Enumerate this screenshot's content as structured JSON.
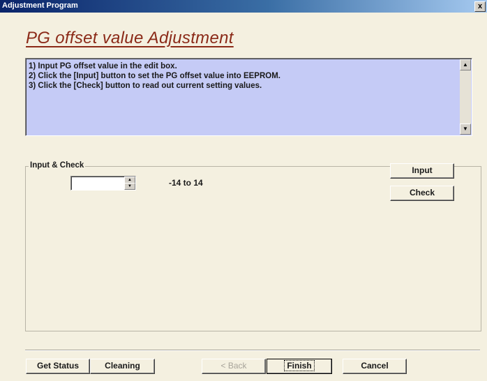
{
  "window": {
    "title": "Adjustment Program",
    "close_label": "x"
  },
  "heading": "PG offset value Adjustment",
  "instructions": [
    "1) Input PG offset value in the edit box.",
    "2) Click the [Input] button to set the PG offset value into EEPROM.",
    "3) Click the [Check] button to read out current setting values."
  ],
  "group": {
    "label": "Input & Check",
    "offset_value": "",
    "range_text": "-14 to 14",
    "input_label": "Input",
    "check_label": "Check"
  },
  "footer": {
    "get_status_label": "Get Status",
    "cleaning_label": "Cleaning",
    "back_label": "< Back",
    "finish_label": "Finish",
    "cancel_label": "Cancel"
  },
  "colors": {
    "title_bar": "#0a246a",
    "heading": "#8b2a18",
    "instructions_bg": "#c5cbf6",
    "window_bg": "#f4f0e0"
  }
}
